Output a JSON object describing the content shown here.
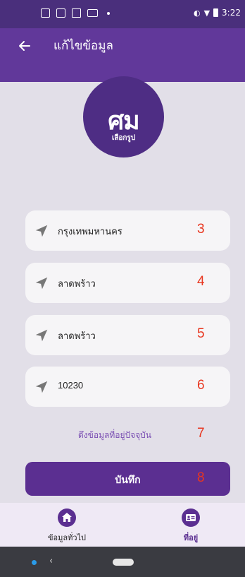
{
  "status_bar": {
    "time": "3:22"
  },
  "app_bar": {
    "title": "แก้ไขข้อมูล"
  },
  "avatar": {
    "logo_text": "ศม",
    "caption": "เลือกรูป"
  },
  "fields": [
    {
      "value": "กรุงเทพมหานคร",
      "annotation": "3"
    },
    {
      "value": "ลาดพร้าว",
      "annotation": "4"
    },
    {
      "value": "ลาดพร้าว",
      "annotation": "5"
    },
    {
      "value": "10230",
      "annotation": "6"
    }
  ],
  "fetch_link": {
    "label": "ดึงข้อมูลที่อยู่ปัจจุบัน",
    "annotation": "7"
  },
  "save_button": {
    "label": "บันทึก",
    "annotation": "8"
  },
  "bottom_nav": {
    "items": [
      {
        "label": "ข้อมูลทั่วไป",
        "icon": "home-icon",
        "active": false
      },
      {
        "label": "ที่อยู่",
        "icon": "contact-card-icon",
        "active": true
      }
    ]
  },
  "colors": {
    "status_bar": "#4a2f7c",
    "app_bar": "#61389a",
    "accent": "#5b2f91",
    "annotation": "#e8361f",
    "background": "#e2dfe8"
  }
}
